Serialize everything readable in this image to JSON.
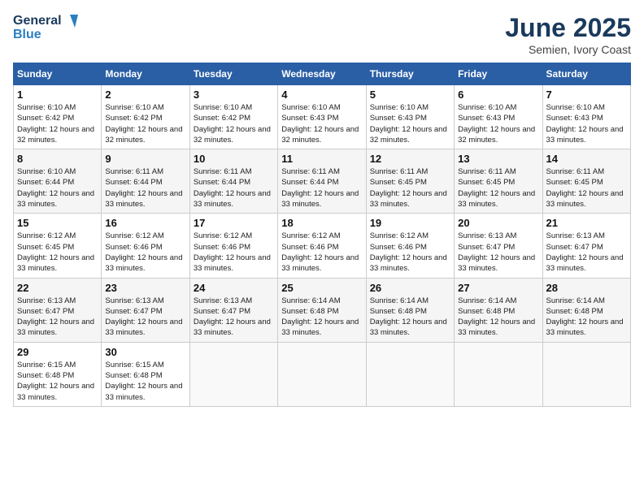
{
  "header": {
    "logo_line1": "General",
    "logo_line2": "Blue",
    "month_year": "June 2025",
    "location": "Semien, Ivory Coast"
  },
  "days_of_week": [
    "Sunday",
    "Monday",
    "Tuesday",
    "Wednesday",
    "Thursday",
    "Friday",
    "Saturday"
  ],
  "weeks": [
    [
      {
        "day": "1",
        "sunrise": "6:10 AM",
        "sunset": "6:42 PM",
        "daylight": "12 hours and 32 minutes."
      },
      {
        "day": "2",
        "sunrise": "6:10 AM",
        "sunset": "6:42 PM",
        "daylight": "12 hours and 32 minutes."
      },
      {
        "day": "3",
        "sunrise": "6:10 AM",
        "sunset": "6:42 PM",
        "daylight": "12 hours and 32 minutes."
      },
      {
        "day": "4",
        "sunrise": "6:10 AM",
        "sunset": "6:43 PM",
        "daylight": "12 hours and 32 minutes."
      },
      {
        "day": "5",
        "sunrise": "6:10 AM",
        "sunset": "6:43 PM",
        "daylight": "12 hours and 32 minutes."
      },
      {
        "day": "6",
        "sunrise": "6:10 AM",
        "sunset": "6:43 PM",
        "daylight": "12 hours and 32 minutes."
      },
      {
        "day": "7",
        "sunrise": "6:10 AM",
        "sunset": "6:43 PM",
        "daylight": "12 hours and 33 minutes."
      }
    ],
    [
      {
        "day": "8",
        "sunrise": "6:10 AM",
        "sunset": "6:44 PM",
        "daylight": "12 hours and 33 minutes."
      },
      {
        "day": "9",
        "sunrise": "6:11 AM",
        "sunset": "6:44 PM",
        "daylight": "12 hours and 33 minutes."
      },
      {
        "day": "10",
        "sunrise": "6:11 AM",
        "sunset": "6:44 PM",
        "daylight": "12 hours and 33 minutes."
      },
      {
        "day": "11",
        "sunrise": "6:11 AM",
        "sunset": "6:44 PM",
        "daylight": "12 hours and 33 minutes."
      },
      {
        "day": "12",
        "sunrise": "6:11 AM",
        "sunset": "6:45 PM",
        "daylight": "12 hours and 33 minutes."
      },
      {
        "day": "13",
        "sunrise": "6:11 AM",
        "sunset": "6:45 PM",
        "daylight": "12 hours and 33 minutes."
      },
      {
        "day": "14",
        "sunrise": "6:11 AM",
        "sunset": "6:45 PM",
        "daylight": "12 hours and 33 minutes."
      }
    ],
    [
      {
        "day": "15",
        "sunrise": "6:12 AM",
        "sunset": "6:45 PM",
        "daylight": "12 hours and 33 minutes."
      },
      {
        "day": "16",
        "sunrise": "6:12 AM",
        "sunset": "6:46 PM",
        "daylight": "12 hours and 33 minutes."
      },
      {
        "day": "17",
        "sunrise": "6:12 AM",
        "sunset": "6:46 PM",
        "daylight": "12 hours and 33 minutes."
      },
      {
        "day": "18",
        "sunrise": "6:12 AM",
        "sunset": "6:46 PM",
        "daylight": "12 hours and 33 minutes."
      },
      {
        "day": "19",
        "sunrise": "6:12 AM",
        "sunset": "6:46 PM",
        "daylight": "12 hours and 33 minutes."
      },
      {
        "day": "20",
        "sunrise": "6:13 AM",
        "sunset": "6:47 PM",
        "daylight": "12 hours and 33 minutes."
      },
      {
        "day": "21",
        "sunrise": "6:13 AM",
        "sunset": "6:47 PM",
        "daylight": "12 hours and 33 minutes."
      }
    ],
    [
      {
        "day": "22",
        "sunrise": "6:13 AM",
        "sunset": "6:47 PM",
        "daylight": "12 hours and 33 minutes."
      },
      {
        "day": "23",
        "sunrise": "6:13 AM",
        "sunset": "6:47 PM",
        "daylight": "12 hours and 33 minutes."
      },
      {
        "day": "24",
        "sunrise": "6:13 AM",
        "sunset": "6:47 PM",
        "daylight": "12 hours and 33 minutes."
      },
      {
        "day": "25",
        "sunrise": "6:14 AM",
        "sunset": "6:48 PM",
        "daylight": "12 hours and 33 minutes."
      },
      {
        "day": "26",
        "sunrise": "6:14 AM",
        "sunset": "6:48 PM",
        "daylight": "12 hours and 33 minutes."
      },
      {
        "day": "27",
        "sunrise": "6:14 AM",
        "sunset": "6:48 PM",
        "daylight": "12 hours and 33 minutes."
      },
      {
        "day": "28",
        "sunrise": "6:14 AM",
        "sunset": "6:48 PM",
        "daylight": "12 hours and 33 minutes."
      }
    ],
    [
      {
        "day": "29",
        "sunrise": "6:15 AM",
        "sunset": "6:48 PM",
        "daylight": "12 hours and 33 minutes."
      },
      {
        "day": "30",
        "sunrise": "6:15 AM",
        "sunset": "6:48 PM",
        "daylight": "12 hours and 33 minutes."
      },
      null,
      null,
      null,
      null,
      null
    ]
  ]
}
